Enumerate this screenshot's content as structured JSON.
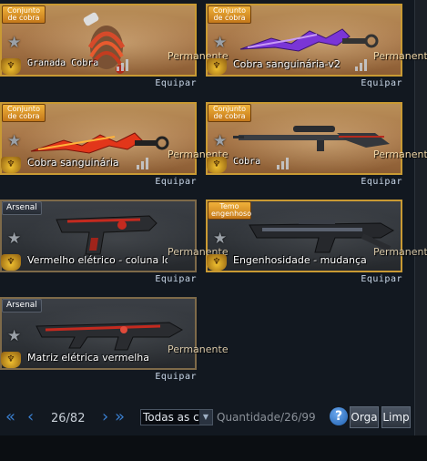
{
  "items": [
    {
      "tag": "Conjunto de cobra",
      "name": "Granada Cobra",
      "permanence": "Permanente",
      "action": "Equipar"
    },
    {
      "tag": "Conjunto de cobra",
      "name": "Cobra sanguinária-v2",
      "permanence": "Permanente",
      "action": "Equipar"
    },
    {
      "tag": "Conjunto de cobra",
      "name": "Cobra sanguinária",
      "permanence": "Permanente",
      "action": "Equipar"
    },
    {
      "tag": "Conjunto de cobra",
      "name": "Cobra",
      "permanence": "Permanente",
      "action": "Equipar"
    },
    {
      "tag": "Arsenal",
      "name": "Vermelho elétrico - coluna lo",
      "permanence": "Permanente",
      "action": "Equipar"
    },
    {
      "tag": "Temo engenhoso",
      "name": "Engenhosidade - mudança",
      "permanence": "Permanente",
      "action": "Equipar"
    },
    {
      "tag": "Arsenal",
      "name": "Matriz elétrica vermelha",
      "permanence": "Permanente",
      "action": "Equipar"
    }
  ],
  "pagination": {
    "current": "26/82"
  },
  "filter": {
    "selected": "Todas as c"
  },
  "quantity": {
    "label": "Quantidade/",
    "value": "26/99"
  },
  "buttons": {
    "help": "?",
    "organize": "Orga",
    "clear": "Limp"
  },
  "colors": {
    "gold_border": "#c99a33",
    "nav_blue": "#3a7fd0"
  },
  "icons": {
    "star": "star-icon",
    "emblem": "dragon-emblem-icon",
    "prev": "double-chevron-left-icon",
    "next": "double-chevron-right-icon"
  }
}
